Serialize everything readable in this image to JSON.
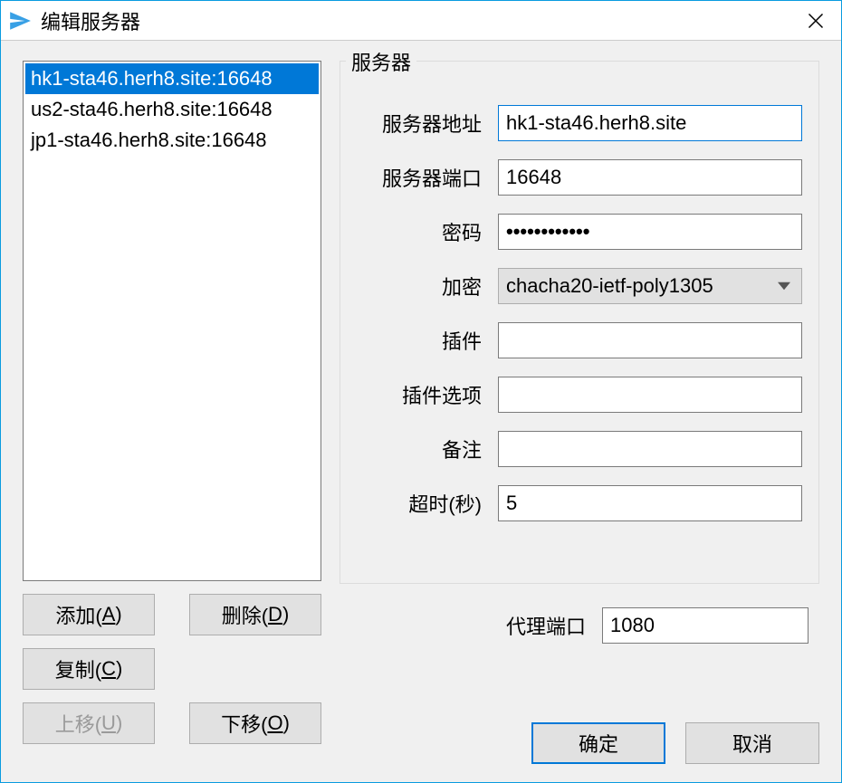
{
  "window": {
    "title": "编辑服务器"
  },
  "serverList": {
    "items": [
      "hk1-sta46.herh8.site:16648",
      "us2-sta46.herh8.site:16648",
      "jp1-sta46.herh8.site:16648"
    ],
    "selectedIndex": 0
  },
  "buttons": {
    "add": "添加(",
    "add_u": "A",
    "add_end": ")",
    "delete": "删除(",
    "delete_u": "D",
    "delete_end": ")",
    "copy": "复制(",
    "copy_u": "C",
    "copy_end": ")",
    "moveUp": "上移(",
    "moveUp_u": "U",
    "moveUp_end": ")",
    "moveDown": "下移(",
    "moveDown_u": "O",
    "moveDown_end": ")",
    "ok": "确定",
    "cancel": "取消"
  },
  "group": {
    "legend": "服务器"
  },
  "form": {
    "addressLabel": "服务器地址",
    "addressValue": "hk1-sta46.herh8.site",
    "portLabel": "服务器端口",
    "portValue": "16648",
    "passwordLabel": "密码",
    "passwordValue": "••••••••••••",
    "encryptLabel": "加密",
    "encryptValue": "chacha20-ietf-poly1305",
    "pluginLabel": "插件",
    "pluginValue": "",
    "pluginOptLabel": "插件选项",
    "pluginOptValue": "",
    "remarkLabel": "备注",
    "remarkValue": "",
    "timeoutLabel": "超时(秒)",
    "timeoutValue": "5",
    "proxyPortLabel": "代理端口",
    "proxyPortValue": "1080"
  }
}
